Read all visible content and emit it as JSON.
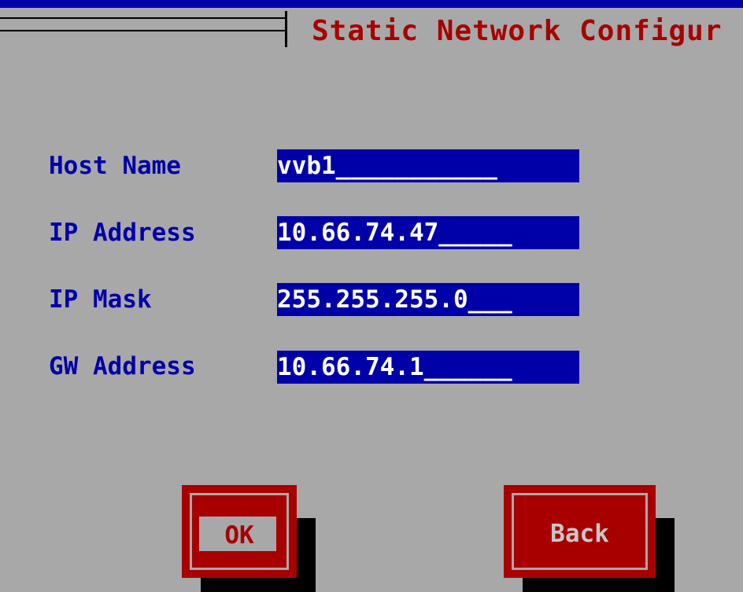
{
  "window": {
    "title": "Static Network Configur"
  },
  "form": {
    "fields": [
      {
        "label": "Host Name",
        "value": "vvb1___________"
      },
      {
        "label": "IP Address",
        "value": "10.66.74.47_____"
      },
      {
        "label": "IP Mask",
        "value": "255.255.255.0___"
      },
      {
        "label": "GW Address",
        "value": "10.66.74.1______"
      }
    ]
  },
  "buttons": {
    "ok_label": "OK",
    "back_label": "Back"
  },
  "colors": {
    "background": "#a8a8a8",
    "accent_blue": "#0000a8",
    "title_red": "#a80000",
    "button_red": "#a80000",
    "shadow": "#000000",
    "field_text": "#ffffff"
  }
}
